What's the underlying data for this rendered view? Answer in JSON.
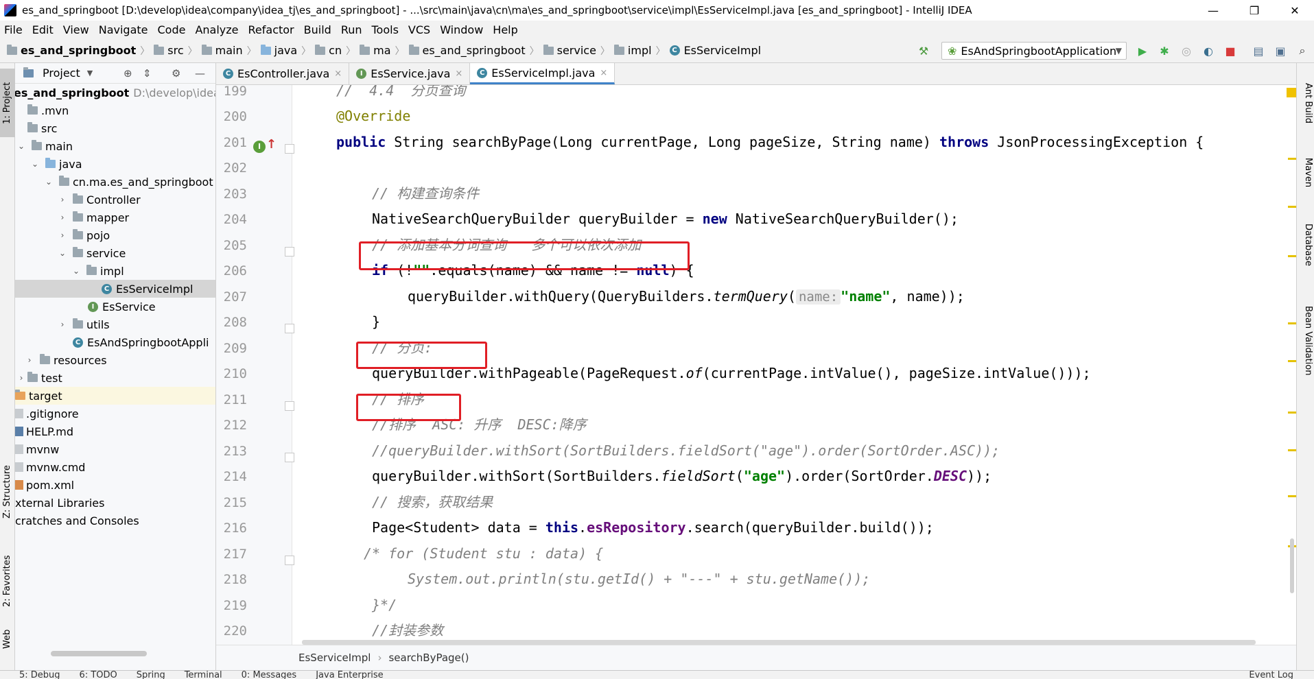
{
  "window": {
    "title": "es_and_springboot [D:\\develop\\idea\\company\\idea_tj\\es_and_springboot] - ...\\src\\main\\java\\cn\\ma\\es_and_springboot\\service\\impl\\EsServiceImpl.java [es_and_springboot] - IntelliJ IDEA",
    "minimize": "—",
    "maximize": "❐",
    "close": "✕"
  },
  "menu": [
    "File",
    "Edit",
    "View",
    "Navigate",
    "Code",
    "Analyze",
    "Refactor",
    "Build",
    "Run",
    "Tools",
    "VCS",
    "Window",
    "Help"
  ],
  "navbar": {
    "crumbs": [
      "es_and_springboot",
      "src",
      "main",
      "java",
      "cn",
      "ma",
      "es_and_springboot",
      "service",
      "impl",
      "EsServiceImpl"
    ],
    "run_config": "EsAndSpringbootApplication"
  },
  "left_tabs": [
    "1: Project",
    "Z: Structure",
    "2: Favorites",
    "Web"
  ],
  "right_tabs": [
    "Ant Build",
    "Maven",
    "Database",
    "Bean Validation"
  ],
  "project": {
    "header": "Project",
    "root_name": "es_and_springboot",
    "root_path": "D:\\develop\\idea\\cor",
    "items": [
      ".mvn",
      "src",
      "main",
      "java",
      "cn.ma.es_and_springboot",
      "Controller",
      "mapper",
      "pojo",
      "service",
      "impl",
      "EsServiceImpl",
      "EsService",
      "utils",
      "EsAndSpringbootAppli",
      "resources",
      "test",
      "target",
      ".gitignore",
      "HELP.md",
      "mvnw",
      "mvnw.cmd",
      "pom.xml",
      "xternal Libraries",
      "cratches and Consoles"
    ]
  },
  "tabs": [
    "EsController.java",
    "EsService.java",
    "EsServiceImpl.java"
  ],
  "editor": {
    "line_numbers": [
      "199",
      "200",
      "201",
      "202",
      "203",
      "204",
      "205",
      "206",
      "207",
      "208",
      "209",
      "210",
      "211",
      "212",
      "213",
      "214",
      "215",
      "216",
      "217",
      "218",
      "219",
      "220"
    ],
    "lines": {
      "l199": "//  4.4  分页查询",
      "l200": "@Override",
      "l201_a": "public",
      "l201_b": " String searchByPage(Long currentPage, Long pageSize, String name) ",
      "l201_c": "throws",
      "l201_d": " JsonProcessingException {",
      "l203": "// 构建查询条件",
      "l204_a": "NativeSearchQueryBuilder queryBuilder = ",
      "l204_b": "new",
      "l204_c": " NativeSearchQueryBuilder();",
      "l205": "// 添加基本分词查询   多个可以依次添加",
      "l206_a": "if",
      "l206_b": " (!",
      "l206_c": "\"\"",
      "l206_d": ".equals(name) && name != ",
      "l206_e": "null",
      "l206_f": ") {",
      "l207_a": "queryBuilder.withQuery(QueryBuilders.",
      "l207_b": "termQuery",
      "l207_c": "(",
      "l207_hint": "name:",
      "l207_d": "\"name\"",
      "l207_e": ", name));",
      "l208": "}",
      "l209": "// 分页:",
      "l210_a": "queryBuilder.withPageable(PageRequest.",
      "l210_b": "of",
      "l210_c": "(currentPage.intValue(), pageSize.intValue()));",
      "l211": "// 排序",
      "l212": "//排序  ASC: 升序  DESC:降序",
      "l213": "//queryBuilder.withSort(SortBuilders.fieldSort(\"age\").order(SortOrder.ASC));",
      "l214_a": "queryBuilder.withSort(SortBuilders.",
      "l214_b": "fieldSort",
      "l214_c": "(",
      "l214_d": "\"age\"",
      "l214_e": ").order(SortOrder.",
      "l214_f": "DESC",
      "l214_g": "));",
      "l215": "// 搜索，获取结果",
      "l216_a": "Page<Student> data = ",
      "l216_b": "this",
      "l216_c": ".",
      "l216_d": "esRepository",
      "l216_e": ".search(queryBuilder.build());",
      "l217": "/* for (Student stu : data) {",
      "l218": "System.out.println(stu.getId() + \"---\" + stu.getName());",
      "l219": "}*/",
      "l220": "//封装参数"
    }
  },
  "bottom_crumb": [
    "EsServiceImpl",
    "searchByPage()"
  ],
  "status_tabs": [
    "5: Debug",
    "6: TODO",
    "Spring",
    "Terminal",
    "0: Messages",
    "Java Enterprise",
    "Event Log"
  ],
  "colors": {
    "highlight_box": "#e01e25",
    "keyword": "#000080",
    "comment": "#808080",
    "string": "#008000",
    "annotation": "#808000"
  }
}
